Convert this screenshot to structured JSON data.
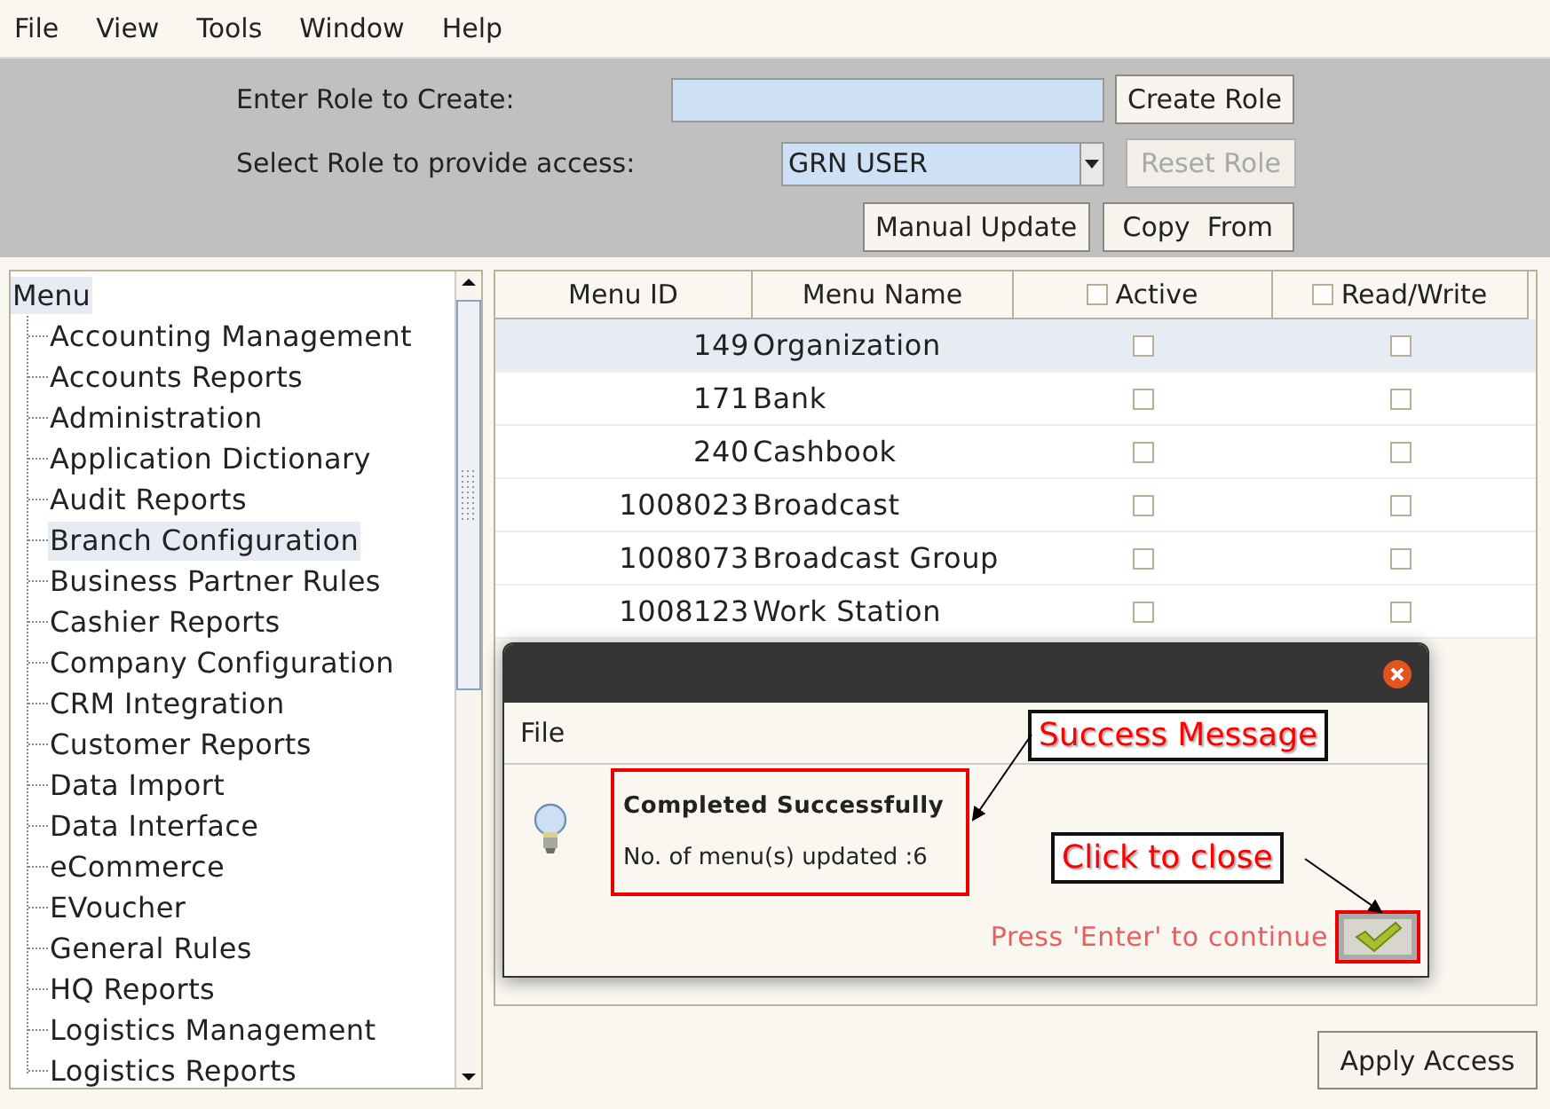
{
  "menubar": [
    {
      "label": "File"
    },
    {
      "label": "View"
    },
    {
      "label": "Tools"
    },
    {
      "label": "Window"
    },
    {
      "label": "Help"
    }
  ],
  "role_form": {
    "create_label": "Enter Role to Create:",
    "create_button": "Create Role",
    "select_label": "Select Role to provide access:",
    "selected_role": "GRN USER",
    "reset_button": {
      "label": "Reset Role",
      "disabled": true
    },
    "manual_update_button": "Manual Update",
    "copy_from_button": "Copy  From"
  },
  "tree": {
    "root": {
      "label": "Menu",
      "selected": true
    },
    "items": [
      {
        "label": "Accounting Management",
        "selected": false
      },
      {
        "label": "Accounts Reports",
        "selected": false
      },
      {
        "label": "Administration",
        "selected": false
      },
      {
        "label": "Application Dictionary",
        "selected": false
      },
      {
        "label": "Audit Reports",
        "selected": false
      },
      {
        "label": "Branch Configuration",
        "selected": true
      },
      {
        "label": "Business Partner Rules",
        "selected": false
      },
      {
        "label": "Cashier Reports",
        "selected": false
      },
      {
        "label": "Company Configuration",
        "selected": false
      },
      {
        "label": "CRM Integration",
        "selected": false
      },
      {
        "label": "Customer Reports",
        "selected": false
      },
      {
        "label": "Data Import",
        "selected": false
      },
      {
        "label": "Data Interface",
        "selected": false
      },
      {
        "label": "eCommerce",
        "selected": false
      },
      {
        "label": "EVoucher",
        "selected": false
      },
      {
        "label": "General Rules",
        "selected": false
      },
      {
        "label": "HQ Reports",
        "selected": false
      },
      {
        "label": "Logistics Management",
        "selected": false
      },
      {
        "label": "Logistics Reports",
        "selected": false
      }
    ]
  },
  "table": {
    "columns": [
      {
        "label": "Menu ID",
        "kind": "text"
      },
      {
        "label": "Menu Name",
        "kind": "text"
      },
      {
        "label": "Active",
        "kind": "checkbox",
        "checked": false
      },
      {
        "label": "Read/Write",
        "kind": "checkbox",
        "checked": false
      }
    ],
    "rows": [
      {
        "id": "149",
        "name": "Organization",
        "active": false,
        "read_write": false,
        "selected": true
      },
      {
        "id": "171",
        "name": "Bank",
        "active": false,
        "read_write": false,
        "selected": false
      },
      {
        "id": "240",
        "name": "Cashbook",
        "active": false,
        "read_write": false,
        "selected": false
      },
      {
        "id": "1008023",
        "name": "Broadcast",
        "active": false,
        "read_write": false,
        "selected": false
      },
      {
        "id": "1008073",
        "name": "Broadcast Group",
        "active": false,
        "read_write": false,
        "selected": false
      },
      {
        "id": "1008123",
        "name": "Work Station",
        "active": false,
        "read_write": false,
        "selected": false
      }
    ]
  },
  "apply_button": "Apply Access",
  "dialog": {
    "menu": [
      {
        "label": "File"
      }
    ],
    "title": "Completed Successfully",
    "message": "No. of menu(s) updated :6",
    "hint": "Press 'Enter' to continue"
  },
  "annotations": [
    {
      "text": "Success Message"
    },
    {
      "text": "Click to close"
    }
  ]
}
